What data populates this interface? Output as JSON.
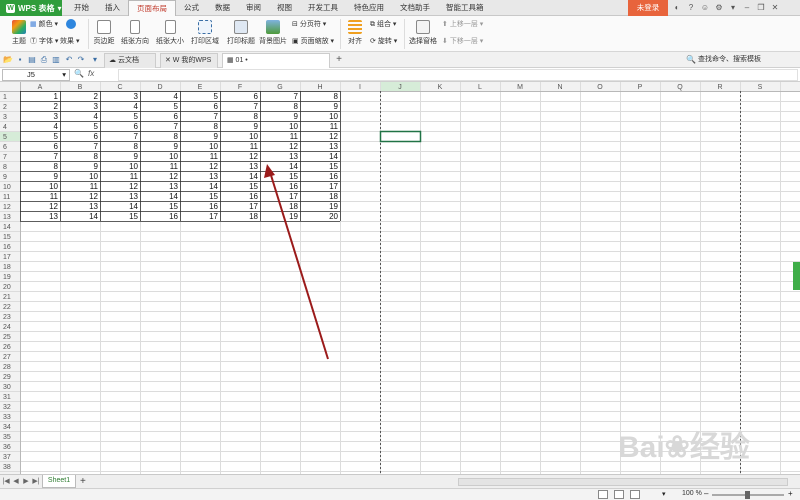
{
  "app": {
    "name": "WPS 表格",
    "menu_tabs": [
      "开始",
      "插入",
      "页面布局",
      "公式",
      "数据",
      "审阅",
      "视图",
      "开发工具",
      "特色应用",
      "文档助手",
      "智能工具箱"
    ],
    "active_tab_index": 2,
    "login_label": "未登录"
  },
  "ribbon": {
    "theme": "主题",
    "colors": "颜色",
    "fonts": "字体",
    "effects": "效果",
    "margins": "页边距",
    "orientation": "纸张方向",
    "size": "纸张大小",
    "print_area": "打印区域",
    "print_titles": "打印标题",
    "background": "背景图片",
    "page_break": "分页符",
    "page_zoom": "页面缩放",
    "align": "对齐",
    "group": "组合",
    "rotate": "旋转",
    "bring_forward": "上移一层",
    "send_backward": "下移一层",
    "select_pane": "选择窗格"
  },
  "doc_tabs": [
    {
      "label": "云文档",
      "active": false
    },
    {
      "label": "我的WPS",
      "active": false
    },
    {
      "label": "01",
      "active": true
    }
  ],
  "search_command": "查找命令、搜索模板",
  "formula_bar": {
    "name_box": "J5",
    "fx": "fx",
    "value": ""
  },
  "grid": {
    "columns": [
      "A",
      "B",
      "C",
      "D",
      "E",
      "F",
      "G",
      "H",
      "I",
      "J",
      "K",
      "L",
      "M",
      "N",
      "O",
      "P",
      "Q",
      "R",
      "S"
    ],
    "row_count": 38,
    "selected_cell": "J5",
    "data": [
      [
        1,
        2,
        3,
        4,
        5,
        6,
        7,
        8
      ],
      [
        2,
        3,
        4,
        5,
        6,
        7,
        8,
        9
      ],
      [
        3,
        4,
        5,
        6,
        7,
        8,
        9,
        10
      ],
      [
        4,
        5,
        6,
        7,
        8,
        9,
        10,
        11
      ],
      [
        5,
        6,
        7,
        8,
        9,
        10,
        11,
        12
      ],
      [
        6,
        7,
        8,
        9,
        10,
        11,
        12,
        13
      ],
      [
        7,
        8,
        9,
        10,
        11,
        12,
        13,
        14
      ],
      [
        8,
        9,
        10,
        11,
        12,
        13,
        14,
        15
      ],
      [
        9,
        10,
        11,
        12,
        13,
        14,
        15,
        16
      ],
      [
        10,
        11,
        12,
        13,
        14,
        15,
        16,
        17
      ],
      [
        11,
        12,
        13,
        14,
        15,
        16,
        17,
        18
      ],
      [
        12,
        13,
        14,
        15,
        16,
        17,
        18,
        19
      ],
      [
        13,
        14,
        15,
        16,
        17,
        18,
        19,
        20
      ]
    ],
    "annotation_arrow_color": "#9b1b1b"
  },
  "sheets": [
    "Sheet1"
  ],
  "status": {
    "zoom": "100 %"
  },
  "colors": {
    "wps_green": "#2f9d3b",
    "active_tab_red": "#c0392b",
    "login_orange": "#e8643c"
  }
}
